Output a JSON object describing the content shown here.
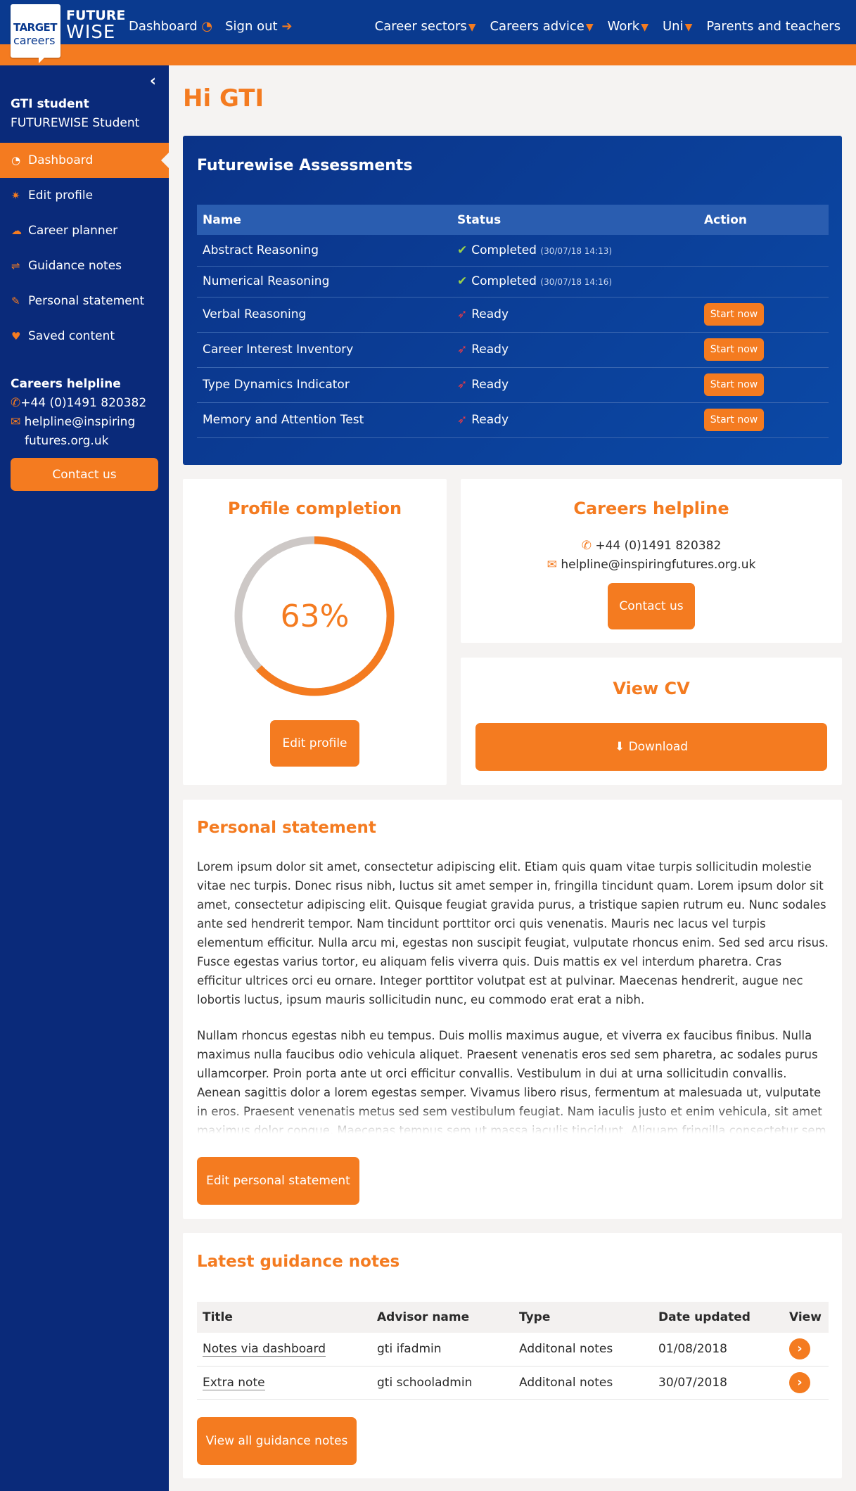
{
  "header": {
    "logo_top": "TARGET",
    "logo_bottom": "careers",
    "brand_line1": "FUTURE",
    "brand_line2": "WISE",
    "left_links": [
      {
        "label": "Dashboard",
        "icon": "dashboard-icon",
        "glyph": "◔"
      },
      {
        "label": "Sign out",
        "icon": "sign-out-icon",
        "glyph": "➔"
      }
    ],
    "right_links": [
      {
        "label": "Career sectors",
        "has_caret": true
      },
      {
        "label": "Careers advice",
        "has_caret": true
      },
      {
        "label": "Work",
        "has_caret": true
      },
      {
        "label": "Uni",
        "has_caret": true
      },
      {
        "label": "Parents and teachers",
        "has_caret": false
      }
    ]
  },
  "sidebar": {
    "collapse_glyph": "‹",
    "user_name": "GTI student",
    "user_role": "FUTUREWISE Student",
    "items": [
      {
        "label": "Dashboard",
        "icon": "dashboard-icon",
        "glyph": "◔",
        "active": true
      },
      {
        "label": "Edit profile",
        "icon": "gear-icon",
        "glyph": "✷",
        "active": false
      },
      {
        "label": "Career planner",
        "icon": "cloud-icon",
        "glyph": "☁",
        "active": false
      },
      {
        "label": "Guidance notes",
        "icon": "signpost-icon",
        "glyph": "⇌",
        "active": false
      },
      {
        "label": "Personal statement",
        "icon": "pencil-icon",
        "glyph": "✎",
        "active": false
      },
      {
        "label": "Saved content",
        "icon": "heart-icon",
        "glyph": "♥",
        "active": false
      }
    ],
    "helpline_title": "Careers helpline",
    "phone": "+44 (0)1491 820382",
    "email_line1": "helpline@inspiring",
    "email_line2": "futures.org.uk",
    "contact_label": "Contact us"
  },
  "greeting": "Hi GTI",
  "assessments": {
    "title": "Futurewise Assessments",
    "columns": [
      "Name",
      "Status",
      "Action"
    ],
    "rows": [
      {
        "name": "Abstract Reasoning",
        "status": "Completed",
        "timestamp": "(30/07/18 14:13)",
        "action": ""
      },
      {
        "name": "Numerical Reasoning",
        "status": "Completed",
        "timestamp": "(30/07/18 14:16)",
        "action": ""
      },
      {
        "name": "Verbal Reasoning",
        "status": "Ready",
        "timestamp": "",
        "action": "Start now"
      },
      {
        "name": "Career Interest Inventory",
        "status": "Ready",
        "timestamp": "",
        "action": "Start now"
      },
      {
        "name": "Type Dynamics Indicator",
        "status": "Ready",
        "timestamp": "",
        "action": "Start now"
      },
      {
        "name": "Memory and Attention Test",
        "status": "Ready",
        "timestamp": "",
        "action": "Start now"
      }
    ]
  },
  "profile": {
    "title": "Profile completion",
    "percent_label": "63%",
    "percent": 63,
    "button": "Edit profile"
  },
  "helpline_card": {
    "title": "Careers helpline",
    "phone": "+44 (0)1491 820382",
    "email": "helpline@inspiringfutures.org.uk",
    "button": "Contact us"
  },
  "cv": {
    "title": "View CV",
    "button": "Download"
  },
  "statement": {
    "title": "Personal statement",
    "paragraph1": "Lorem ipsum dolor sit amet, consectetur adipiscing elit. Etiam quis quam vitae turpis sollicitudin molestie vitae nec turpis. Donec risus nibh, luctus sit amet semper in, fringilla tincidunt quam. Lorem ipsum dolor sit amet, consectetur adipiscing elit. Quisque feugiat gravida purus, a tristique sapien rutrum eu. Nunc sodales ante sed hendrerit tempor. Nam tincidunt porttitor orci quis venenatis. Mauris nec lacus vel turpis elementum efficitur. Nulla arcu mi, egestas non suscipit feugiat, vulputate rhoncus enim. Sed sed arcu risus. Fusce egestas varius tortor, eu aliquam felis viverra quis. Duis mattis ex vel interdum pharetra. Cras efficitur ultrices orci eu ornare. Integer porttitor volutpat est at pulvinar. Maecenas hendrerit, augue nec lobortis luctus, ipsum mauris sollicitudin nunc, eu commodo erat erat a nibh.",
    "paragraph2": "Nullam rhoncus egestas nibh eu tempus. Duis mollis maximus augue, et viverra ex faucibus finibus. Nulla maximus nulla faucibus odio vehicula aliquet. Praesent venenatis eros sed sem pharetra, ac sodales purus ullamcorper. Proin porta ante ut orci efficitur convallis. Vestibulum in dui at urna sollicitudin convallis. Aenean sagittis dolor a lorem egestas semper. Vivamus libero risus, fermentum at malesuada ut, vulputate in eros. Praesent venenatis metus sed sem vestibulum feugiat. Nam iaculis justo et enim vehicula, sit amet maximus dolor congue. Maecenas tempus sem ut massa iaculis tincidunt. Aliquam fringilla consectetur sem a varius. Mauris dictum enim nec libero facilisis",
    "button": "Edit personal statement"
  },
  "guidance": {
    "title": "Latest guidance notes",
    "columns": [
      "Title",
      "Advisor name",
      "Type",
      "Date updated",
      "View"
    ],
    "rows": [
      {
        "title": "Notes via dashboard",
        "advisor": "gti ifadmin",
        "type": "Additonal notes",
        "date": "01/08/2018"
      },
      {
        "title": "Extra note",
        "advisor": "gti schooladmin",
        "type": "Additonal notes",
        "date": "30/07/2018"
      }
    ],
    "button": "View all guidance notes"
  },
  "colors": {
    "navy": "#0a2a7a",
    "orange": "#f47b20",
    "ring_track": "#cdc8c6"
  }
}
